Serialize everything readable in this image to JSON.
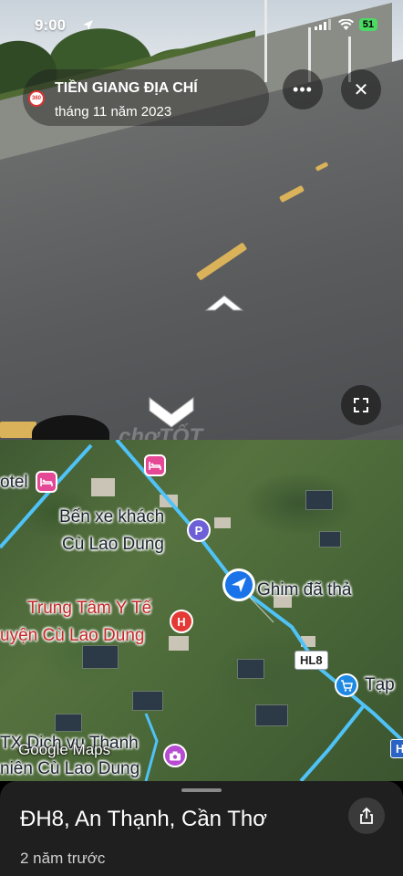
{
  "status_bar": {
    "time": "9:00",
    "battery": "51",
    "icons": [
      "location-arrow-icon",
      "signal-icon",
      "wifi-icon",
      "battery-icon"
    ]
  },
  "street_view": {
    "title": "TIỀN GIANG ĐỊA CHÍ",
    "date": "tháng 11 năm 2023",
    "logo_text": "360",
    "more_label": "•••",
    "close_label": "✕",
    "watermark": "chợTỐT",
    "icons": [
      "more-icon",
      "close-icon",
      "expand-icon",
      "nav-arrow-forward-icon",
      "nav-arrow-back-icon"
    ]
  },
  "map": {
    "labels": {
      "hotel": "otel",
      "bus_station_line1": "Bến xe khách",
      "bus_station_line2": "Cù Lao Dung",
      "pin_label": "Ghim đã thả",
      "medical_line1": "Trung Tâm Y Tế",
      "medical_line2": "uyện Cù Lao Dung",
      "shop": "Tạp",
      "company_line1": "TX Dịch vụ Thanh",
      "company_line2": "niên Cù Lao Dung"
    },
    "route_badges": {
      "hl8": "HL8",
      "edge": "H"
    },
    "poi_icons": {
      "parking": "P",
      "hospital": "H"
    },
    "attribution": "Google Maps",
    "colors": {
      "route": "#4fc3f7",
      "pin": "#1a73e8",
      "hospital_text": "#c62828"
    }
  },
  "sheet": {
    "title": "ĐH8, An Thạnh, Cần Thơ",
    "subtitle": "2 năm trước"
  }
}
